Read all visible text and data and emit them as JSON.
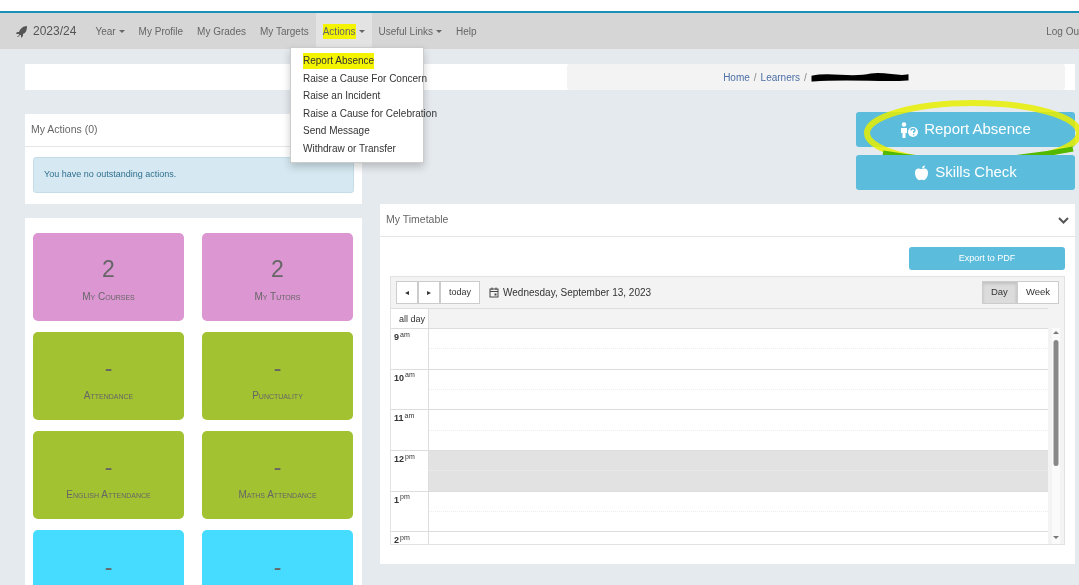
{
  "navbar": {
    "brand": "2023/24",
    "items": [
      {
        "label": "Year",
        "dropdown": true,
        "highlighted": false
      },
      {
        "label": "My Profile",
        "dropdown": false,
        "highlighted": false
      },
      {
        "label": "My Grades",
        "dropdown": false,
        "highlighted": false
      },
      {
        "label": "My Targets",
        "dropdown": false,
        "highlighted": false
      },
      {
        "label": "Actions",
        "dropdown": true,
        "highlighted": true,
        "expanded": true,
        "menu": [
          {
            "label": "Report Absence",
            "highlighted": true
          },
          {
            "label": "Raise a Cause For Concern",
            "highlighted": false
          },
          {
            "label": "Raise an Incident",
            "highlighted": false
          },
          {
            "label": "Raise a Cause for Celebration",
            "highlighted": false
          },
          {
            "label": "Send Message",
            "highlighted": false
          },
          {
            "label": "Withdraw or Transfer",
            "highlighted": false
          }
        ]
      },
      {
        "label": "Useful Links",
        "dropdown": true,
        "highlighted": false
      },
      {
        "label": "Help",
        "dropdown": false,
        "highlighted": false
      }
    ],
    "right_link": "Log Ou"
  },
  "breadcrumb": [
    {
      "kind": "link",
      "label": "Home"
    },
    {
      "kind": "separator",
      "label": "/"
    },
    {
      "kind": "link",
      "label": "Learners"
    },
    {
      "kind": "separator",
      "label": "/"
    },
    {
      "kind": "redacted"
    }
  ],
  "my_actions": {
    "title": "My Actions (0)",
    "message": "You have no outstanding actions."
  },
  "action_buttons": [
    {
      "label": "Report Absence",
      "kind": "absence",
      "circled": true
    },
    {
      "label": "Skills Check",
      "kind": "apple",
      "circled": false
    }
  ],
  "tiles": [
    {
      "value": "2",
      "label": "My Courses",
      "color": "#dc96d2"
    },
    {
      "value": "2",
      "label": "My Tutors",
      "color": "#dc96d2"
    },
    {
      "value": "-",
      "label": "Attendance",
      "color": "#a2c232"
    },
    {
      "value": "-",
      "label": "Punctuality",
      "color": "#a2c232"
    },
    {
      "value": "-",
      "label": "English Attendance",
      "color": "#a2c232"
    },
    {
      "value": "-",
      "label": "Maths Attendance",
      "color": "#a2c232"
    },
    {
      "value": "-",
      "color": "#45dcff"
    },
    {
      "value": "-",
      "color": "#45dcff"
    }
  ],
  "timetable": {
    "title": "My Timetable",
    "export_button": "Export to PDF",
    "nav_buttons": [
      "◂",
      "▸",
      "today"
    ],
    "date": "Wednesday, September 13, 2023",
    "views": [
      {
        "label": "Day",
        "selected": true
      },
      {
        "label": "Week",
        "selected": false
      }
    ],
    "all_day_label": "all day",
    "hours": [
      {
        "hour": "9",
        "suffix": "am",
        "shaded": false
      },
      {
        "hour": "10",
        "suffix": "am",
        "shaded": false
      },
      {
        "hour": "11",
        "suffix": "am",
        "shaded": false
      },
      {
        "hour": "12",
        "suffix": "pm",
        "shaded": true
      },
      {
        "hour": "1",
        "suffix": "pm",
        "shaded": false
      },
      {
        "hour": "2",
        "suffix": "pm",
        "shaded": false
      }
    ]
  }
}
